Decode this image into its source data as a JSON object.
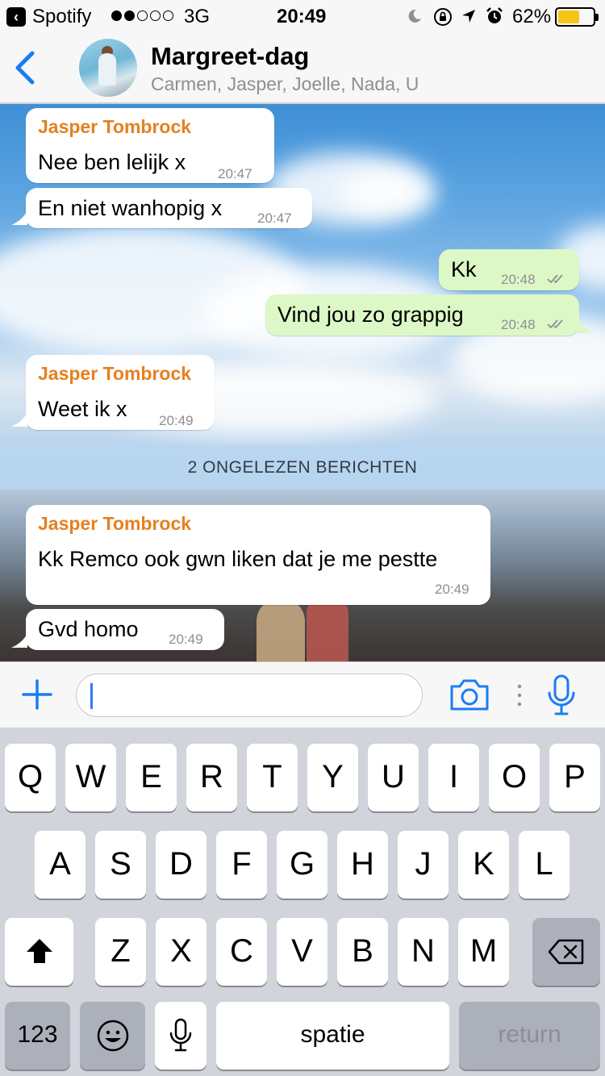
{
  "status_bar": {
    "back_app": "Spotify",
    "signal_on": 2,
    "signal_total": 5,
    "network": "3G",
    "time": "20:49",
    "battery_percent": "62%",
    "battery_level": 0.62,
    "battery_color": "#f5c518"
  },
  "header": {
    "title": "Margreet-dag",
    "members": "Carmen, Jasper, Joelle, Nada, U",
    "accent_color": "#1a7cf5"
  },
  "messages": [
    {
      "direction": "in",
      "sender": "Jasper Tombrock",
      "text": "Nee ben lelijk x",
      "time": "20:47"
    },
    {
      "direction": "in",
      "text": "En niet wanhopig x",
      "time": "20:47"
    },
    {
      "direction": "out",
      "text": "Kk",
      "time": "20:48"
    },
    {
      "direction": "out",
      "text": "Vind jou zo grappig",
      "time": "20:48"
    },
    {
      "direction": "in",
      "sender": "Jasper Tombrock",
      "text": "Weet ik x",
      "time": "20:49"
    },
    {
      "direction": "in",
      "sender": "Jasper Tombrock",
      "text": "Kk Remco ook gwn liken dat je me pestte",
      "time": "20:49"
    },
    {
      "direction": "in",
      "text": "Gvd homo",
      "time": "20:49"
    }
  ],
  "unread_banner": "2 ONGELEZEN BERICHTEN",
  "composer": {
    "value": "",
    "placeholder": ""
  },
  "keyboard": {
    "row1": [
      "Q",
      "W",
      "E",
      "R",
      "T",
      "Y",
      "U",
      "I",
      "O",
      "P"
    ],
    "row2": [
      "A",
      "S",
      "D",
      "F",
      "G",
      "H",
      "J",
      "K",
      "L"
    ],
    "row3": [
      "Z",
      "X",
      "C",
      "V",
      "B",
      "N",
      "M"
    ],
    "numbers_key": "123",
    "space_key": "spatie",
    "return_key": "return"
  },
  "icons": {
    "back": "chevron-left-icon",
    "plus": "plus-icon",
    "camera": "camera-icon",
    "mic": "microphone-icon",
    "shift": "shift-icon",
    "backspace": "backspace-icon",
    "emoji": "emoji-icon",
    "dictation": "dictation-icon"
  }
}
